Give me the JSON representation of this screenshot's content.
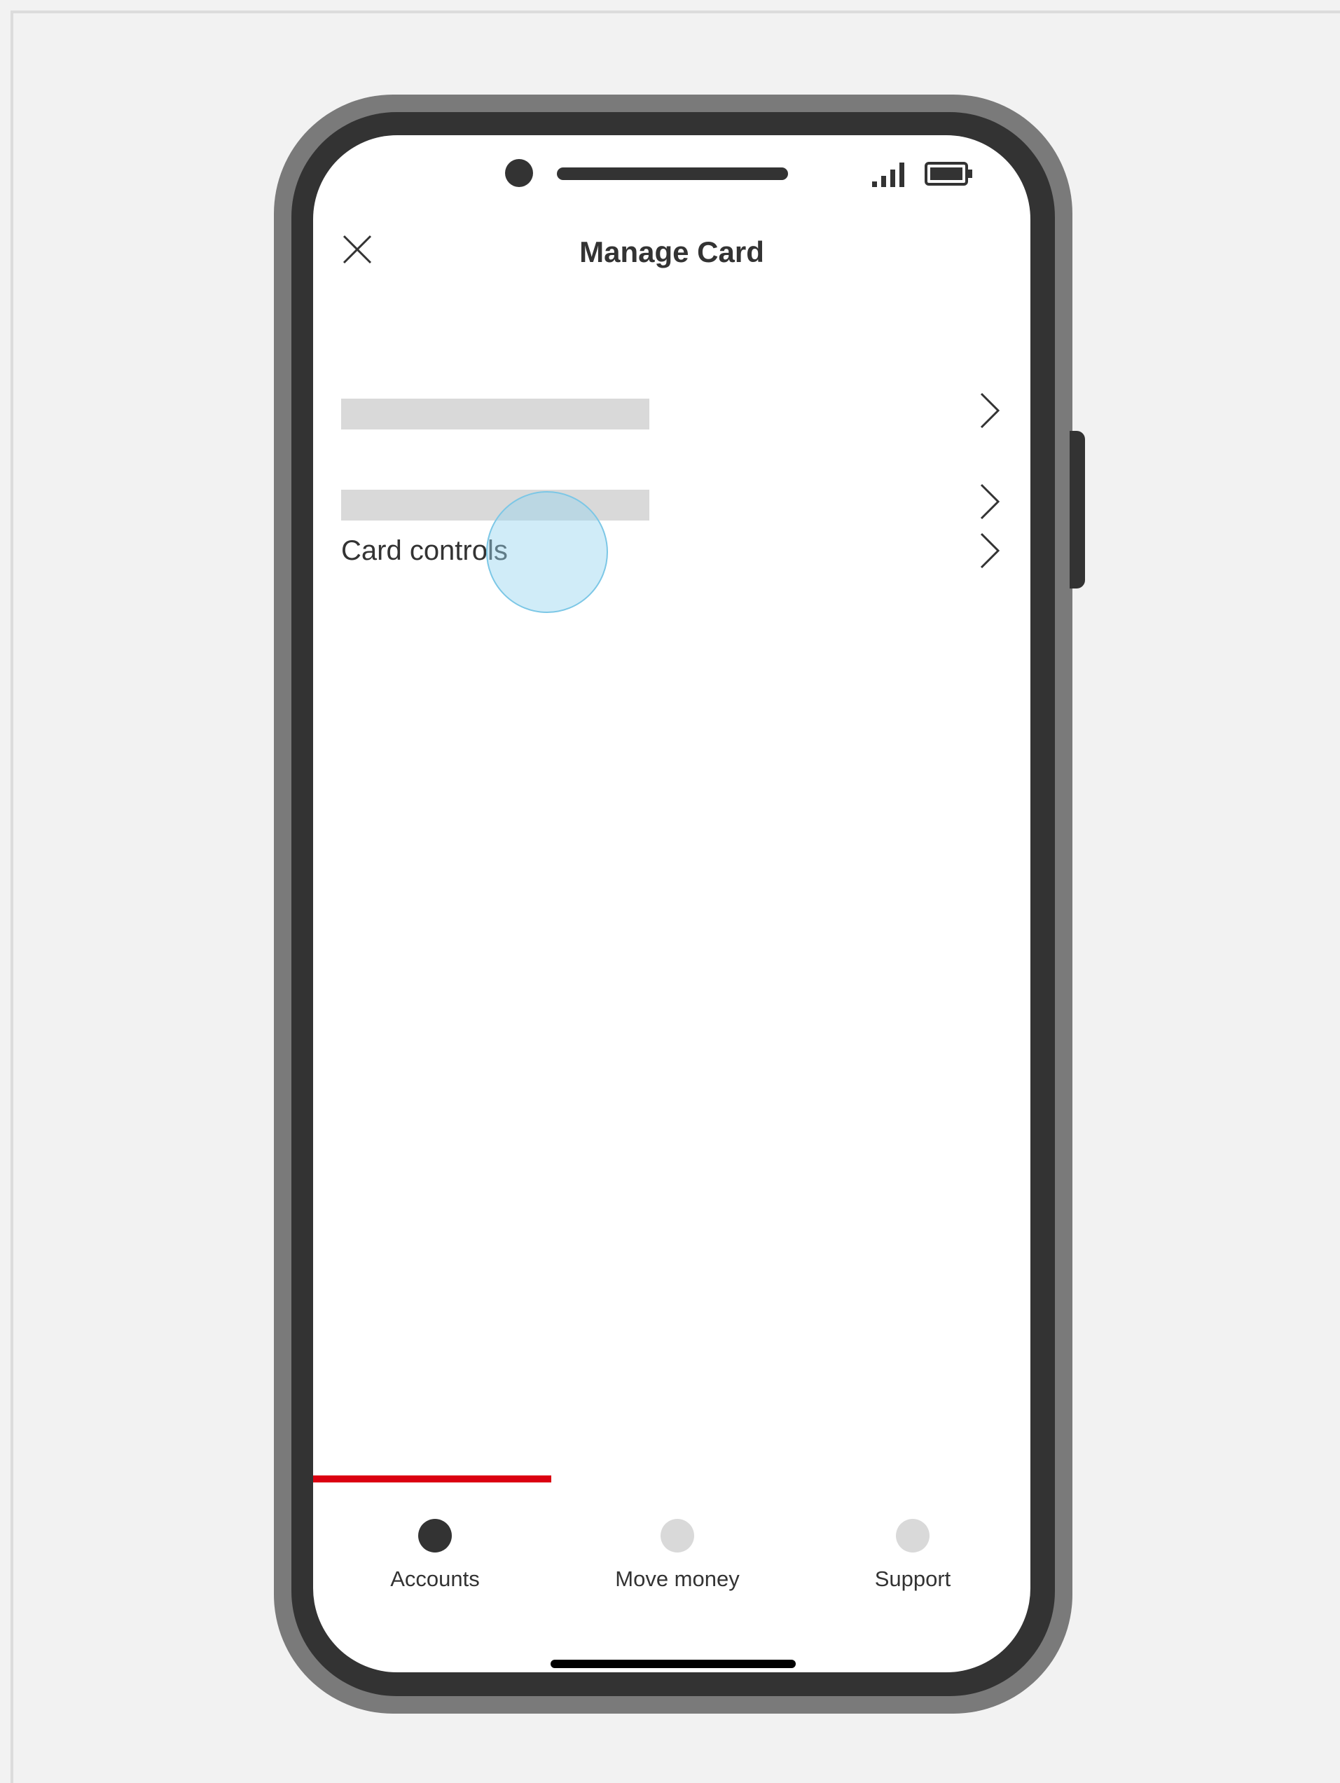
{
  "header": {
    "title": "Manage Card",
    "close_icon": "close-icon"
  },
  "status_bar": {
    "signal_icon": "signal-icon",
    "battery_icon": "battery-icon"
  },
  "menu": {
    "items": [
      {
        "label": "",
        "placeholder": true,
        "icon": "chevron-right-icon"
      },
      {
        "label": "",
        "placeholder": true,
        "icon": "chevron-right-icon"
      },
      {
        "label": "Card controls",
        "placeholder": false,
        "icon": "chevron-right-icon"
      }
    ]
  },
  "bottom_nav": {
    "items": [
      {
        "label": "Accounts",
        "active": true
      },
      {
        "label": "Move money",
        "active": false
      },
      {
        "label": "Support",
        "active": false
      }
    ],
    "active_color": "#db0011",
    "active_dot_color": "#333333",
    "inactive_dot_color": "#d9d9d9"
  },
  "colors": {
    "background": "#f2f2f2",
    "phone_shell": "#7a7a7a",
    "phone_bezel": "#333333",
    "text": "#333333",
    "touch_indicator": "#96d4f0"
  }
}
